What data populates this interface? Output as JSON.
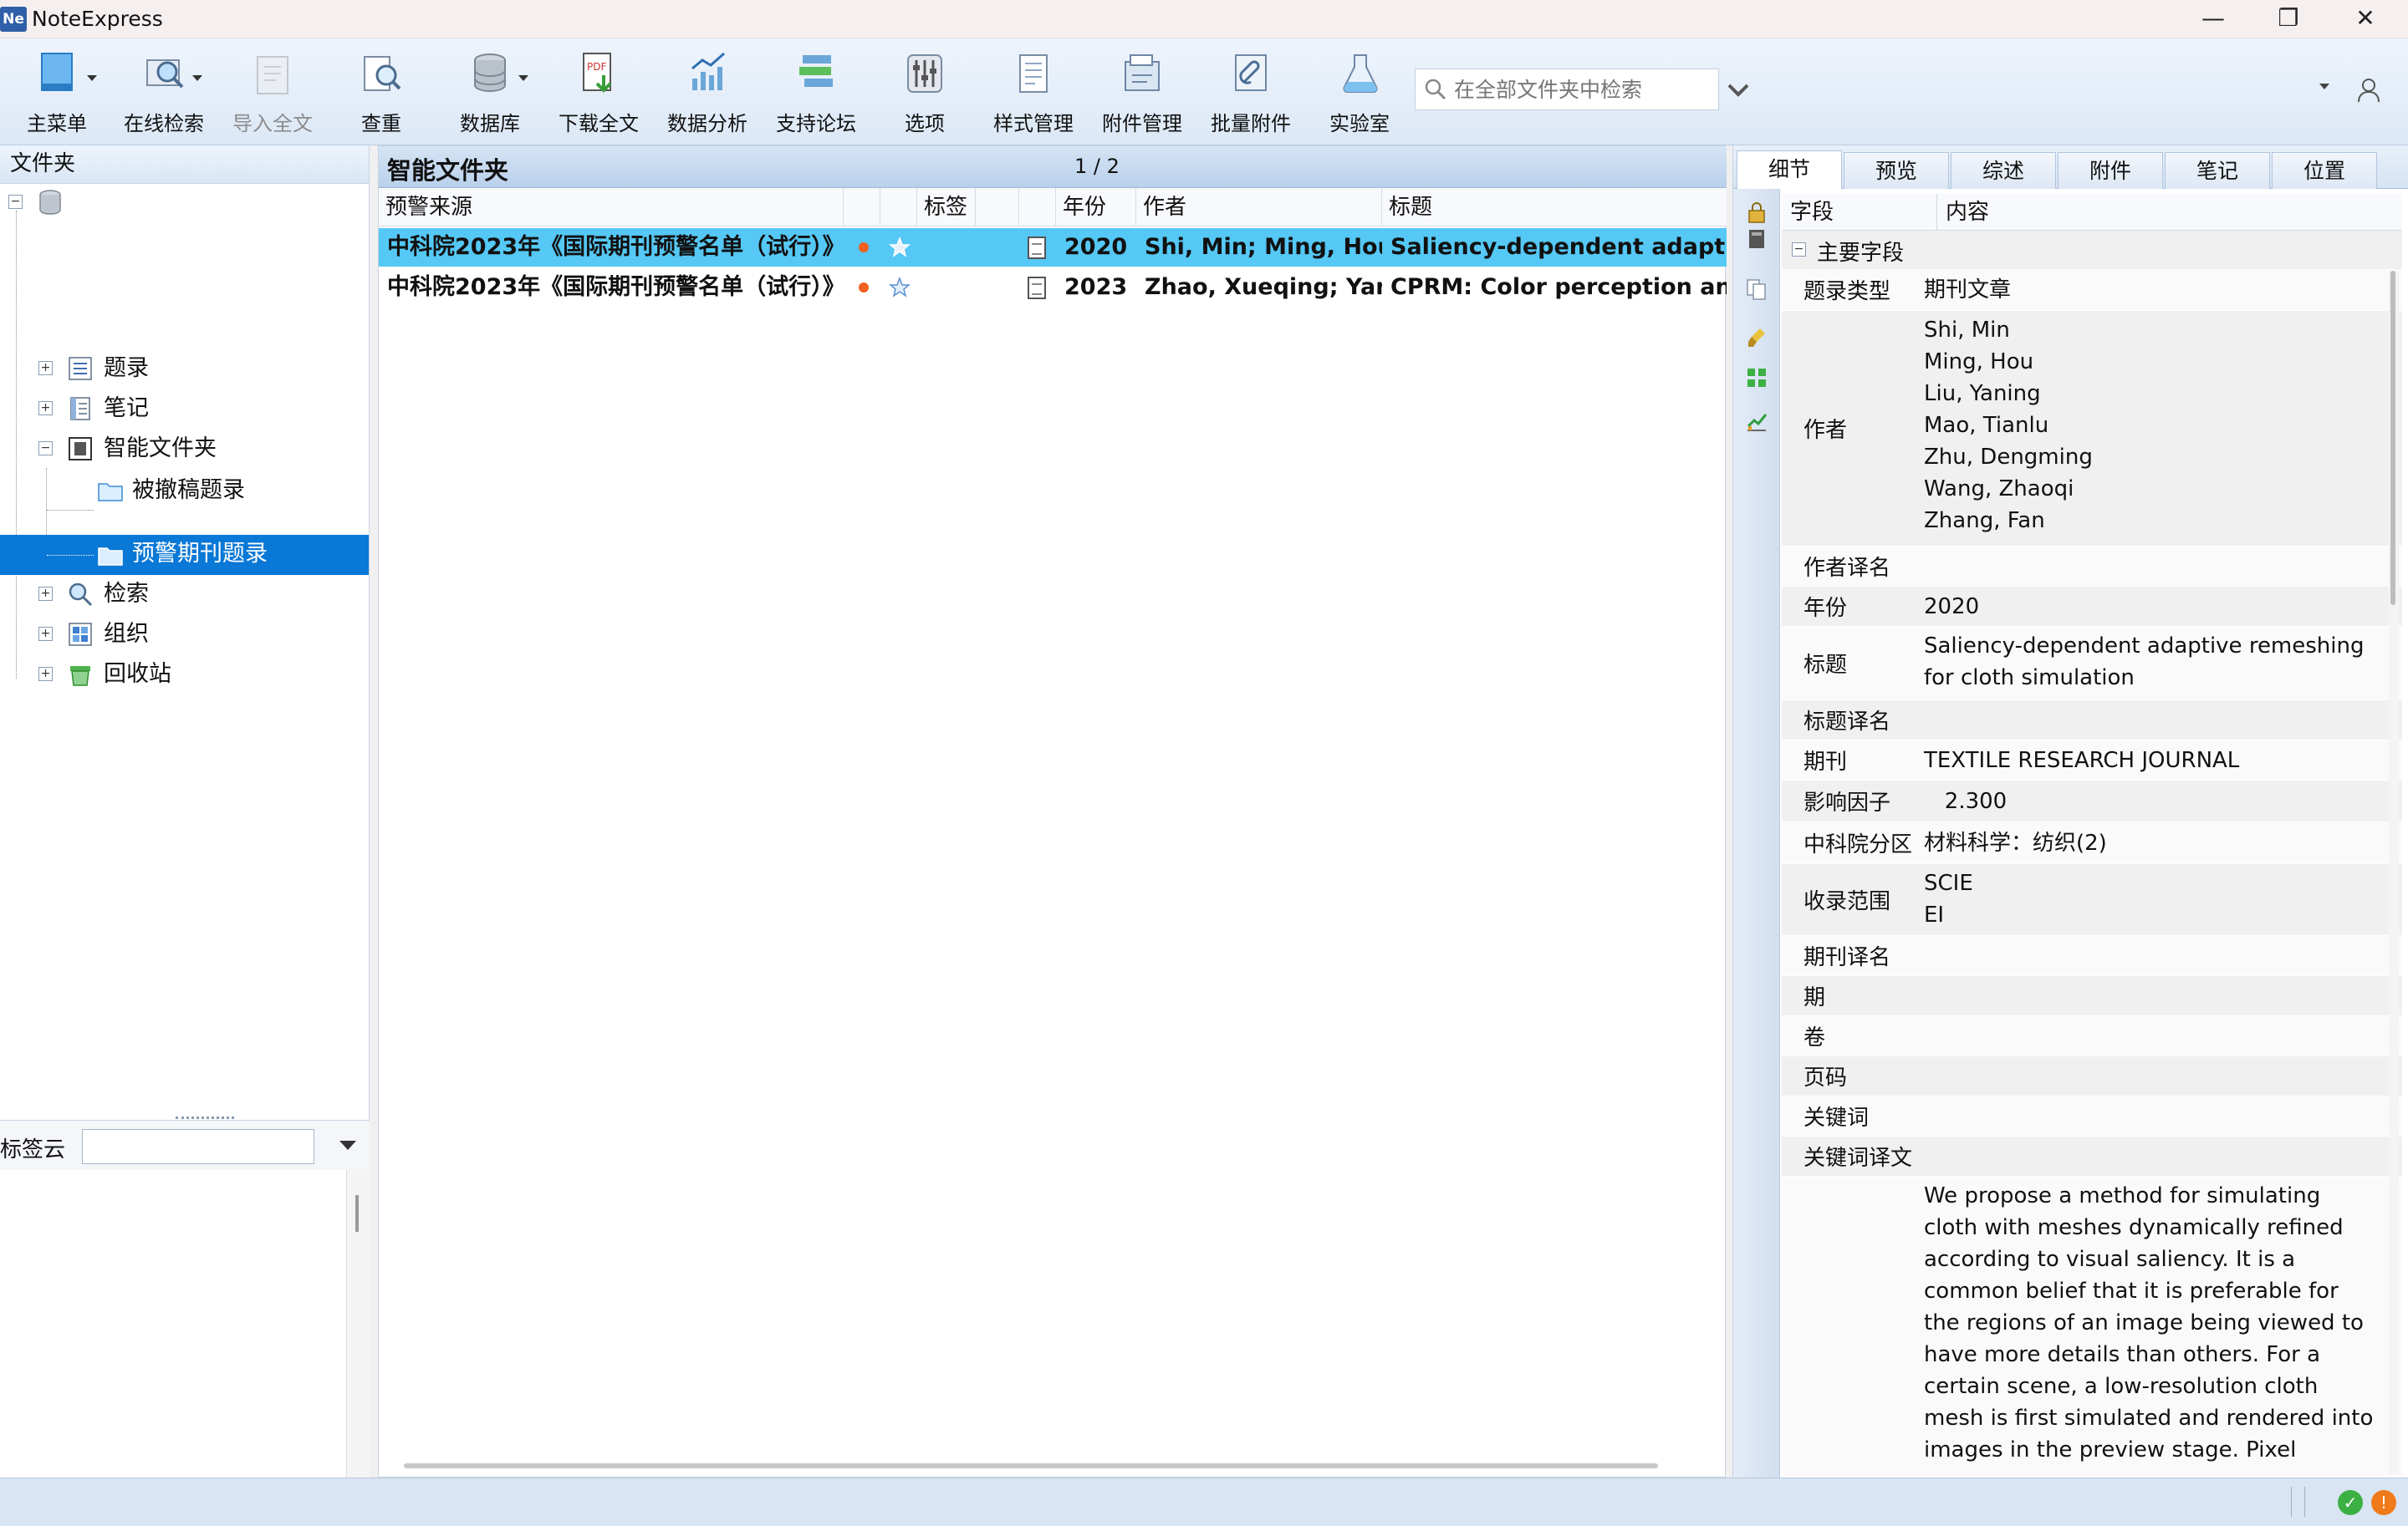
{
  "app": {
    "title": "NoteExpress",
    "logo_text": "Ne"
  },
  "window": {
    "minimize": "—",
    "restore": "❐",
    "close": "✕"
  },
  "toolbar": {
    "buttons": [
      {
        "label": "主菜单",
        "icon": "main-menu-icon"
      },
      {
        "label": "在线检索",
        "icon": "online-search-icon"
      },
      {
        "label": "导入全文",
        "icon": "import-fulltext-icon",
        "disabled": true
      },
      {
        "label": "查重",
        "icon": "duplicate-check-icon"
      },
      {
        "label": "数据库",
        "icon": "database-icon"
      },
      {
        "label": "下载全文",
        "icon": "download-fulltext-icon"
      },
      {
        "label": "数据分析",
        "icon": "data-analysis-icon"
      },
      {
        "label": "支持论坛",
        "icon": "forum-icon"
      },
      {
        "label": "选项",
        "icon": "options-icon"
      },
      {
        "label": "样式管理",
        "icon": "style-manager-icon"
      },
      {
        "label": "附件管理",
        "icon": "attachment-manager-icon"
      },
      {
        "label": "批量附件",
        "icon": "batch-attachment-icon"
      },
      {
        "label": "实验室",
        "icon": "lab-icon"
      }
    ],
    "search_placeholder": "在全部文件夹中检索"
  },
  "left": {
    "header": "文件夹",
    "tree": [
      {
        "label": "题录",
        "icon": "records-icon"
      },
      {
        "label": "笔记",
        "icon": "notes-icon"
      },
      {
        "label": "智能文件夹",
        "icon": "smart-folder-icon"
      },
      {
        "label": "被撤稿题录",
        "icon": "folder-icon"
      },
      {
        "label": "预警期刊题录",
        "icon": "folder-icon",
        "selected": true
      },
      {
        "label": "检索",
        "icon": "search-icon"
      },
      {
        "label": "组织",
        "icon": "organize-icon"
      },
      {
        "label": "回收站",
        "icon": "recycle-bin-icon"
      }
    ],
    "tagcloud_label": "标签云"
  },
  "center": {
    "title": "智能文件夹",
    "page": "1 / 2",
    "columns": {
      "source": "预警来源",
      "tag": "标签",
      "year": "年份",
      "author": "作者",
      "title": "标题"
    },
    "rows": [
      {
        "source": "中科院2023年《国际期刊预警名单（试行）》",
        "year": "2020",
        "author": "Shi, Min; Ming, Hou;",
        "title": "Saliency-dependent adaptiv",
        "selected": true
      },
      {
        "source": "中科院2023年《国际期刊预警名单（试行）》",
        "year": "2023",
        "author": "Zhao, Xueqing; Yan...",
        "title": "CPRM: Color perception and",
        "selected": false
      }
    ]
  },
  "right": {
    "tabs": [
      "细节",
      "预览",
      "综述",
      "附件",
      "笔记",
      "位置"
    ],
    "header": {
      "field": "字段",
      "content": "内容"
    },
    "section": "主要字段",
    "fields": [
      {
        "name": "题录类型",
        "value": "期刊文章"
      },
      {
        "name": "作者",
        "value": [
          "Shi, Min",
          "Ming, Hou",
          "Liu, Yaning",
          "Mao, Tianlu",
          "Zhu, Dengming",
          "Wang, Zhaoqi",
          "Zhang, Fan"
        ]
      },
      {
        "name": "作者译名",
        "value": ""
      },
      {
        "name": "年份",
        "value": "2020"
      },
      {
        "name": "标题",
        "value": [
          "Saliency-dependent adaptive remeshing",
          "for cloth simulation"
        ]
      },
      {
        "name": "标题译名",
        "value": ""
      },
      {
        "name": "期刊",
        "value": "TEXTILE RESEARCH JOURNAL"
      },
      {
        "name": "影响因子",
        "value": "   2.300"
      },
      {
        "name": "中科院分区",
        "value": "材料科学：纺织(2)"
      },
      {
        "name": "收录范围",
        "value": [
          "SCIE",
          "EI"
        ]
      },
      {
        "name": "期刊译名",
        "value": ""
      },
      {
        "name": "期",
        "value": ""
      },
      {
        "name": "卷",
        "value": ""
      },
      {
        "name": "页码",
        "value": ""
      },
      {
        "name": "关键词",
        "value": ""
      },
      {
        "name": "关键词译文",
        "value": ""
      },
      {
        "name": "",
        "value": [
          "We propose a method for simulating",
          "cloth with meshes dynamically refined",
          "according to visual saliency. It is a",
          "common belief that it is preferable for",
          "the regions of an image being viewed to",
          "have more details than others. For a",
          "certain scene, a low-resolution cloth",
          "mesh is first simulated and rendered into",
          "images in the preview stage. Pixel"
        ]
      }
    ]
  },
  "colors": {
    "accent": "#0a78d6",
    "row_selected": "#55c8f5",
    "dot": "#f06020"
  }
}
